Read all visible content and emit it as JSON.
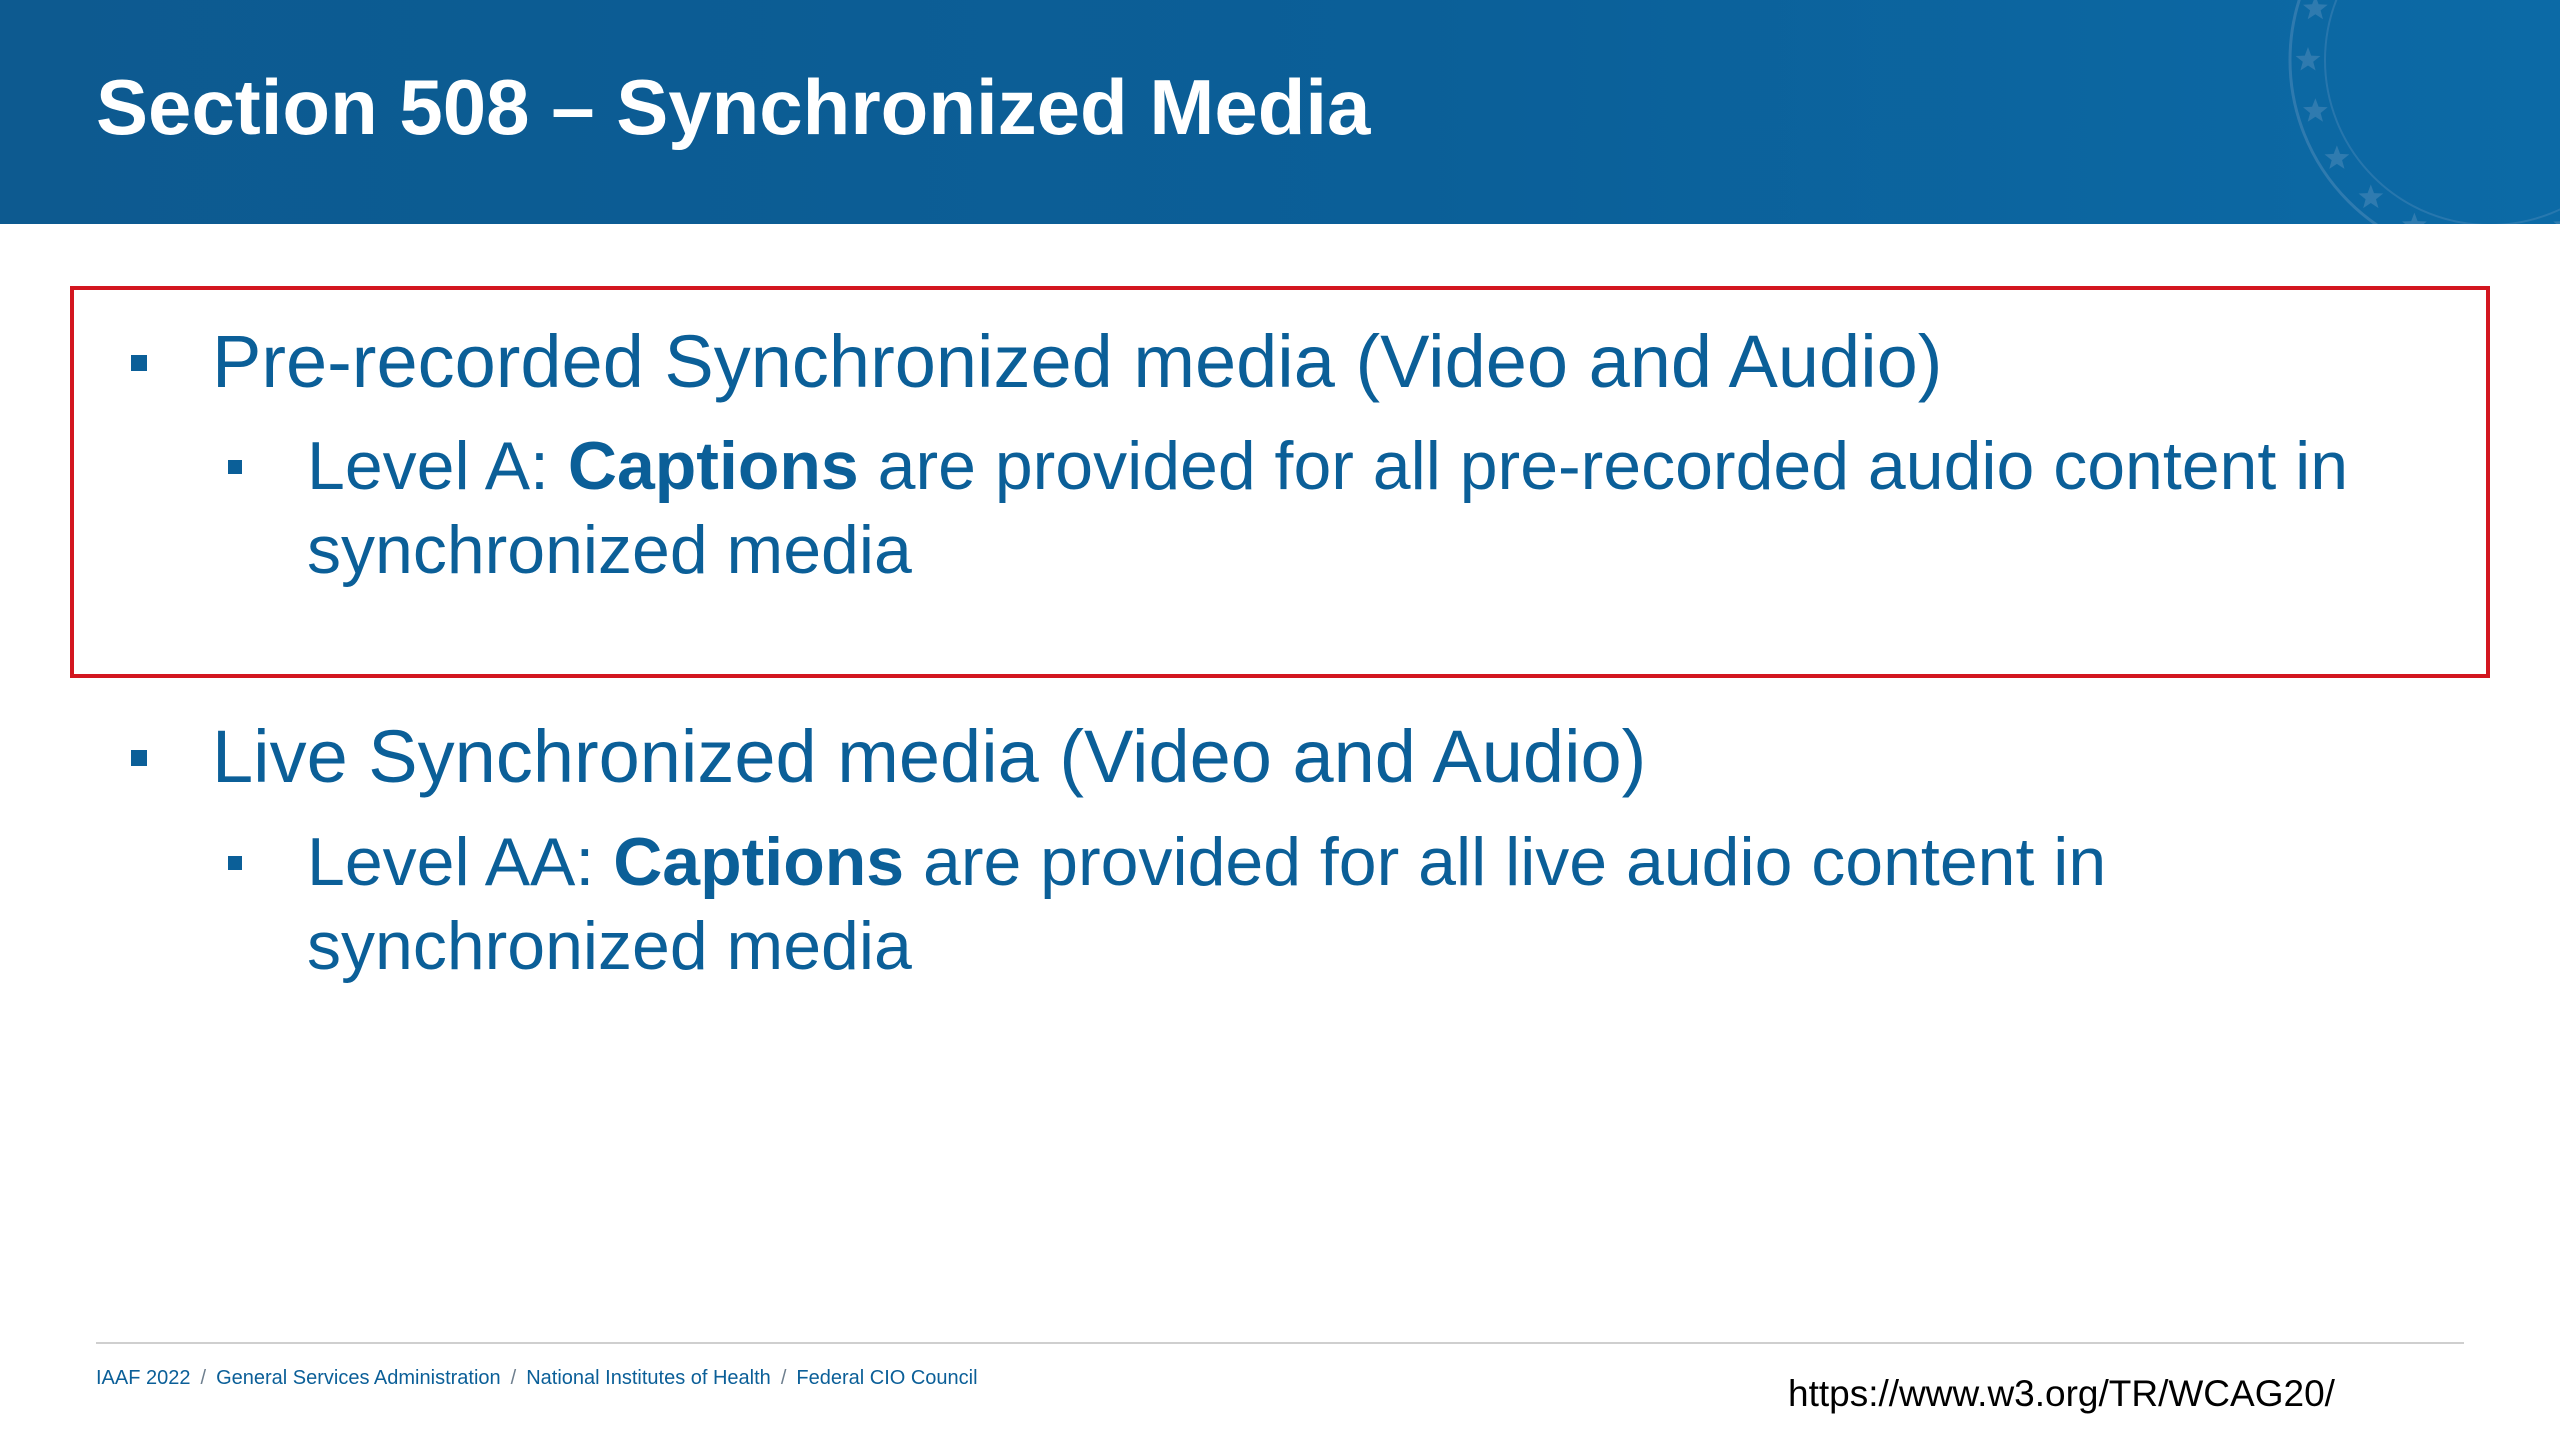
{
  "slide": {
    "title": "Section 508 – Synchronized Media",
    "items": [
      {
        "text": "Pre-recorded Synchronized media (Video and Audio)",
        "sub": {
          "prefix": "Level A: ",
          "bold": "Captions",
          "rest": " are provided for all pre-recorded audio content in synchronized media"
        }
      },
      {
        "text": "Live Synchronized media (Video and Audio)",
        "sub": {
          "prefix": "Level AA: ",
          "bold": "Captions",
          "rest": " are provided for all live audio content in synchronized media"
        }
      }
    ]
  },
  "footer": {
    "items": [
      "IAAF 2022",
      "General Services Administration",
      "National Institutes of Health",
      "Federal CIO Council"
    ],
    "separator": "/",
    "url": "https://www.w3.org/TR/WCAG20/"
  },
  "colors": {
    "header_blue": "#0b5f98",
    "text_blue": "#0b5f98",
    "highlight_red": "#d3161f"
  },
  "icons": {
    "seal": "star-seal-icon",
    "bullet": "square-bullet-icon"
  }
}
